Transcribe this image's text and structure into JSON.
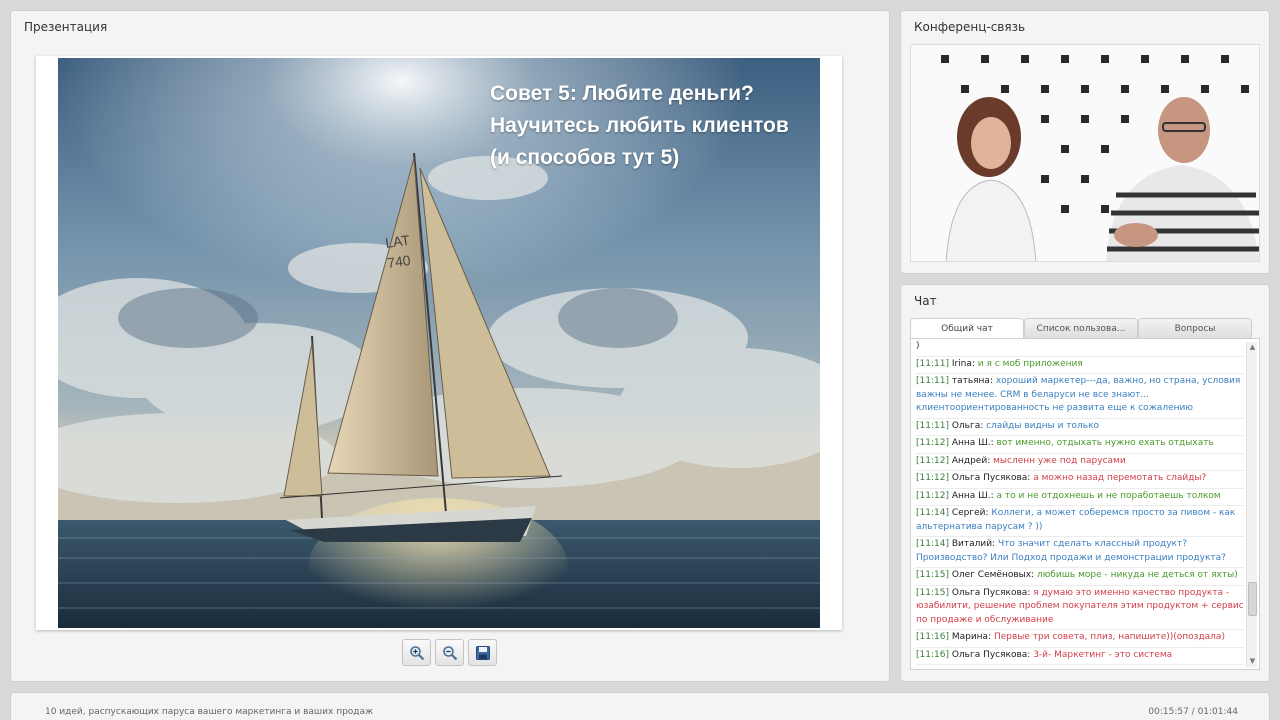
{
  "presentation": {
    "title": "Презентация",
    "slide_lines": [
      "Совет 5: Любите деньги?",
      "Научитесь любить клиентов",
      "(и способов тут 5)"
    ],
    "tools": [
      {
        "icon": "zoom-in-icon"
      },
      {
        "icon": "zoom-out-icon"
      },
      {
        "icon": "save-icon"
      }
    ]
  },
  "video": {
    "title": "Конференц-связь"
  },
  "chat": {
    "title": "Чат",
    "tabs": [
      "Общий чат",
      "Список пользова...",
      "Вопросы"
    ],
    "messages": [
      {
        "time": "",
        "user": "",
        "text": ")",
        "color": "#333333"
      },
      {
        "time": "[11:11]",
        "user": "Irina:",
        "text": "и я с моб приложения",
        "color": "#4a9a2a"
      },
      {
        "time": "[11:11]",
        "user": "татьяна:",
        "text": "хороший маркетер---да, важно, но страна, условия важны не менее. CRM в беларуси не все знают... клиентоориентированность не развита еще к сожалению",
        "color": "#3a7fc0"
      },
      {
        "time": "[11:11]",
        "user": "Ольга:",
        "text": "слайды видны и только",
        "color": "#3a7fc0"
      },
      {
        "time": "[11:12]",
        "user": "Анна Ш.:",
        "text": "вот именно, отдыхать нужно ехать отдыхать",
        "color": "#4a9a2a"
      },
      {
        "time": "[11:12]",
        "user": "Андрей:",
        "text": "мысленн уже под парусами",
        "color": "#d0404a"
      },
      {
        "time": "[11:12]",
        "user": "Ольга Пусякова:",
        "text": "а можно назад перемотать слайды?",
        "color": "#d0404a"
      },
      {
        "time": "[11:12]",
        "user": "Анна Ш.:",
        "text": "а то и не отдохнешь и не поработаешь толком",
        "color": "#4a9a2a"
      },
      {
        "time": "[11:14]",
        "user": "Сергей:",
        "text": "Коллеги, а может соберемся просто за пивом - как альтернатива парусам ? ))",
        "color": "#3a7fc0"
      },
      {
        "time": "[11:14]",
        "user": "Виталий:",
        "text": "Что значит сделать классный продукт? Производство? Или Подход продажи и демонстрации продукта?",
        "color": "#3a7fc0"
      },
      {
        "time": "[11:15]",
        "user": "Олег Семёновых:",
        "text": "любишь море - никуда не деться от яхты)",
        "color": "#4a9a2a"
      },
      {
        "time": "[11:15]",
        "user": "Ольга Пусякова:",
        "text": "я думаю это именно качество продукта - юзабилити, решение проблем покупателя этим продуктом + сервис по продаже и обслуживание",
        "color": "#d0404a"
      },
      {
        "time": "[11:16]",
        "user": "Марина:",
        "text": "Первые три совета, плиз, напишите))(опоздала)",
        "color": "#d0404a"
      },
      {
        "time": "[11:16]",
        "user": "Ольга Пусякова:",
        "text": "3-й- Маркетинг - это система",
        "color": "#d0404a"
      }
    ]
  },
  "bottom": {
    "title": "10 идей, распускающих паруса вашего маркетинга и ваших продаж",
    "time": "00:15:57 / 01:01:44"
  }
}
